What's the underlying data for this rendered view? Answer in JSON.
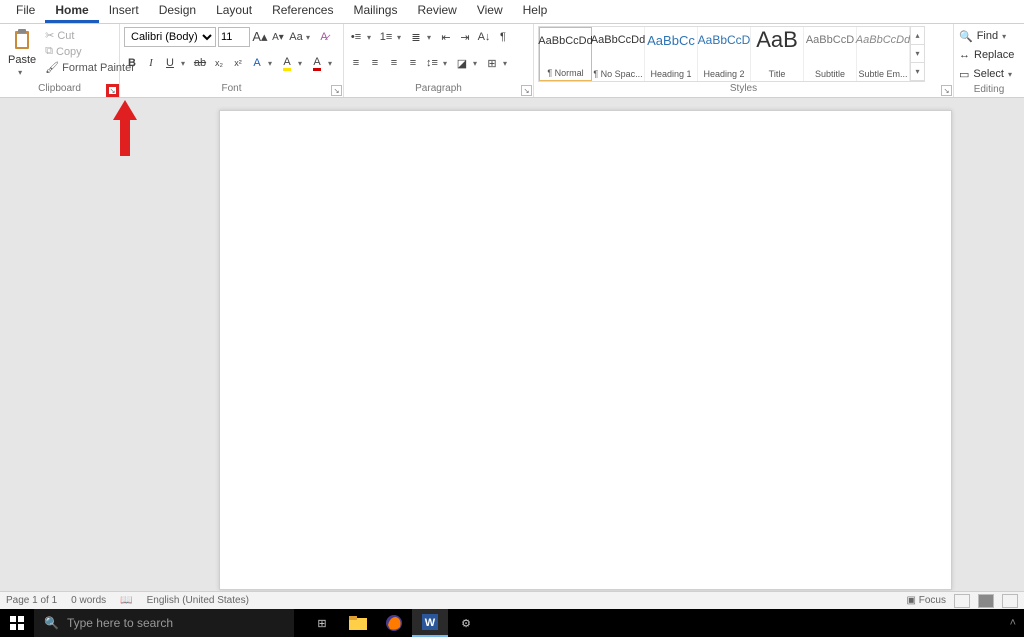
{
  "tabs": [
    "File",
    "Home",
    "Insert",
    "Design",
    "Layout",
    "References",
    "Mailings",
    "Review",
    "View",
    "Help"
  ],
  "active_tab": "Home",
  "clipboard": {
    "paste": "Paste",
    "cut": "Cut",
    "copy": "Copy",
    "format_painter": "Format Painter",
    "label": "Clipboard"
  },
  "font": {
    "name": "Calibri (Body)",
    "size": "11",
    "label": "Font"
  },
  "paragraph": {
    "label": "Paragraph"
  },
  "styles": {
    "label": "Styles",
    "items": [
      {
        "preview": "AaBbCcDd",
        "name": "¶ Normal",
        "cls": ""
      },
      {
        "preview": "AaBbCcDd",
        "name": "¶ No Spac...",
        "cls": ""
      },
      {
        "preview": "AaBbCc",
        "name": "Heading 1",
        "cls": "h1"
      },
      {
        "preview": "AaBbCcD",
        "name": "Heading 2",
        "cls": "h2"
      },
      {
        "preview": "AaB",
        "name": "Title",
        "cls": "title"
      },
      {
        "preview": "AaBbCcD",
        "name": "Subtitle",
        "cls": "sub"
      },
      {
        "preview": "AaBbCcDd",
        "name": "Subtle Em...",
        "cls": "em"
      }
    ]
  },
  "editing": {
    "find": "Find",
    "replace": "Replace",
    "select": "Select",
    "label": "Editing"
  },
  "status": {
    "page": "Page 1 of 1",
    "words": "0 words",
    "lang": "English (United States)",
    "focus": "Focus"
  },
  "taskbar": {
    "search_placeholder": "Type here to search"
  },
  "annotation": {
    "target": "clipboard-launcher"
  }
}
